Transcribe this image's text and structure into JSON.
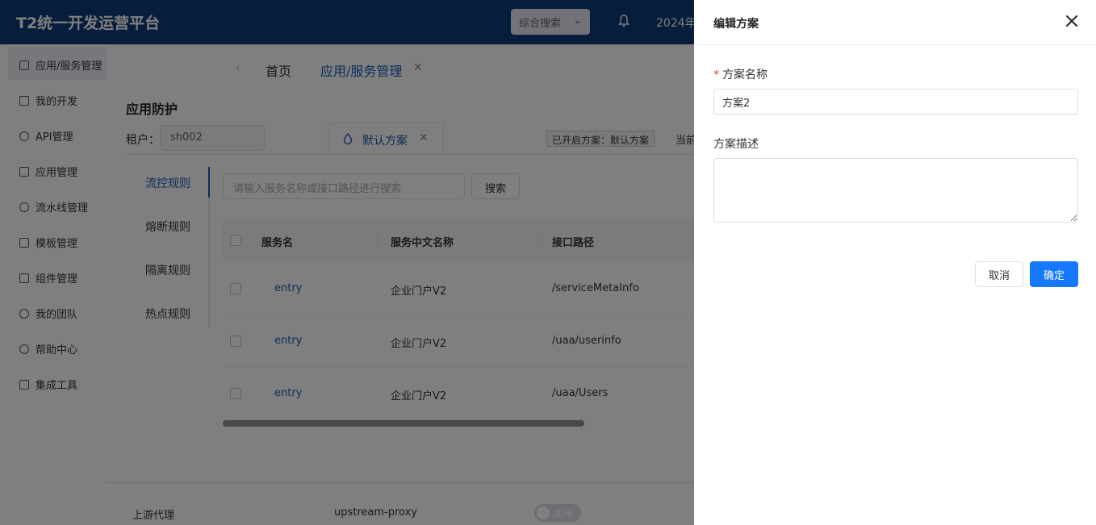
{
  "app": {
    "brand": "T2统一开发运营平台",
    "top_search": "综合搜索",
    "top_date": "2024年"
  },
  "sidebar": {
    "items": [
      {
        "label": "应用/服务管理",
        "icon": "grid-icon"
      },
      {
        "label": "我的开发",
        "icon": "doc-icon"
      },
      {
        "label": "API管理",
        "icon": "api-icon"
      },
      {
        "label": "应用管理",
        "icon": "apps-icon"
      },
      {
        "label": "流水线管理",
        "icon": "pipeline-icon"
      },
      {
        "label": "模板管理",
        "icon": "template-icon"
      },
      {
        "label": "组件管理",
        "icon": "component-icon"
      },
      {
        "label": "我的团队",
        "icon": "team-icon"
      },
      {
        "label": "帮助中心",
        "icon": "help-icon"
      },
      {
        "label": "集成工具",
        "icon": "folder-icon"
      }
    ]
  },
  "tabs": {
    "home": "首页",
    "app_service": "应用/服务管理"
  },
  "background_row": {
    "label": "上游代理",
    "value": "upstream-proxy",
    "toggle_text": "关闭"
  },
  "modal": {
    "title": "应用防护",
    "tenant_label": "租户：",
    "tenant_value": "sh002",
    "plan_tab": "默认方案",
    "status_badge": "已开启方案：默认方案",
    "status_cut": "当前",
    "rule_nav": [
      "流控规则",
      "熔断规则",
      "隔离规则",
      "热点规则"
    ],
    "search_placeholder": "请输入服务名称或接口路径进行搜索",
    "search_button": "搜索",
    "table": {
      "headers": [
        "服务名",
        "服务中文名称",
        "接口路径"
      ],
      "rows": [
        [
          "entry",
          "企业门户V2",
          "/serviceMetaInfo"
        ],
        [
          "entry",
          "企业门户V2",
          "/uaa/userinfo"
        ],
        [
          "entry",
          "企业门户V2",
          "/uaa/Users"
        ]
      ]
    }
  },
  "drawer": {
    "title": "编辑方案",
    "name_label": "方案名称",
    "name_required_mark": "*",
    "name_value": "方案2",
    "desc_label": "方案描述",
    "desc_value": "",
    "cancel_label": "取消",
    "ok_label": "确定"
  },
  "colors": {
    "primary": "#1677ff",
    "link": "#1a5db3",
    "required": "#e53935",
    "topbar": "#0d3a78"
  }
}
